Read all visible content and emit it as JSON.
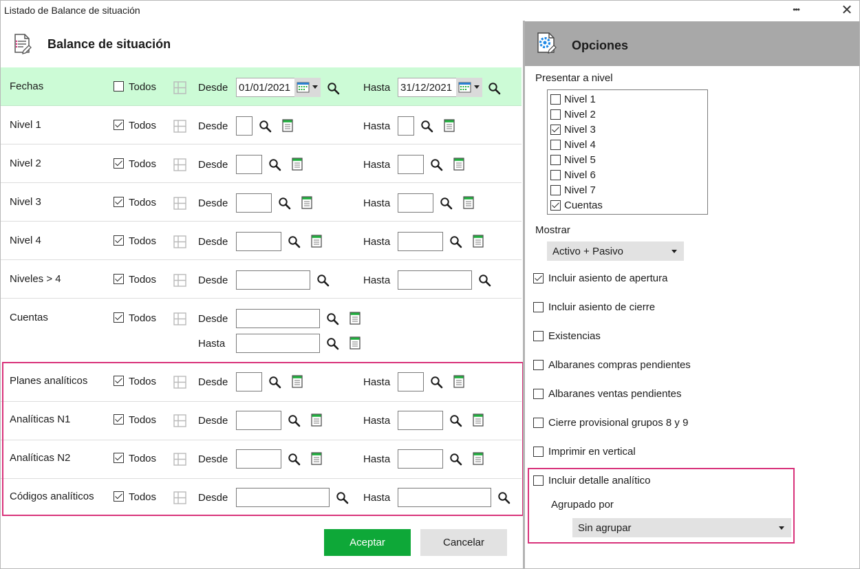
{
  "window": {
    "title": "Listado de Balance de situación",
    "menu_glyph": "•••",
    "close_glyph": "✕"
  },
  "left": {
    "title": "Balance de situación",
    "todos_label": "Todos",
    "desde_label": "Desde",
    "hasta_label": "Hasta",
    "rows": [
      {
        "label": "Fechas",
        "todos_checked": false,
        "desde": "01/01/2021",
        "hasta": "31/12/2021"
      },
      {
        "label": "Nivel 1",
        "todos_checked": true
      },
      {
        "label": "Nivel 2",
        "todos_checked": true
      },
      {
        "label": "Nivel 3",
        "todos_checked": true
      },
      {
        "label": "Nivel 4",
        "todos_checked": true
      },
      {
        "label": "Niveles > 4",
        "todos_checked": true
      },
      {
        "label": "Cuentas",
        "todos_checked": true
      },
      {
        "label": "Planes  analíticos",
        "todos_checked": true
      },
      {
        "label": "Analíticas  N1",
        "todos_checked": true
      },
      {
        "label": "Analíticas  N2",
        "todos_checked": true
      },
      {
        "label": "Códigos analíticos",
        "todos_checked": true
      }
    ],
    "accept_label": "Aceptar",
    "cancel_label": "Cancelar"
  },
  "right": {
    "title": "Opciones",
    "presentar_label": "Presentar a nivel",
    "levels": [
      {
        "label": "Nivel 1",
        "checked": false
      },
      {
        "label": "Nivel 2",
        "checked": false
      },
      {
        "label": "Nivel 3",
        "checked": true
      },
      {
        "label": "Nivel 4",
        "checked": false
      },
      {
        "label": "Nivel 5",
        "checked": false
      },
      {
        "label": "Nivel 6",
        "checked": false
      },
      {
        "label": "Nivel 7",
        "checked": false
      },
      {
        "label": "Cuentas",
        "checked": true
      }
    ],
    "mostrar_label": "Mostrar",
    "mostrar_value": "Activo + Pasivo",
    "options": [
      {
        "label": "Incluir asiento de apertura",
        "checked": true
      },
      {
        "label": "Incluir asiento de cierre",
        "checked": false
      },
      {
        "label": "Existencias",
        "checked": false
      },
      {
        "label": "Albaranes compras pendientes",
        "checked": false
      },
      {
        "label": "Albaranes ventas pendientes",
        "checked": false
      },
      {
        "label": "Cierre provisional grupos 8 y 9",
        "checked": false
      },
      {
        "label": "Imprimir en vertical",
        "checked": false
      },
      {
        "label": "Incluir detalle analítico",
        "checked": false
      }
    ],
    "agrupado_label": "Agrupado por",
    "agrupado_value": "Sin agrupar"
  },
  "colors": {
    "accent_green": "#0ea838",
    "highlight_pink": "#d8327a",
    "fechas_row_bg": "#ccfbd6",
    "panel_header_gray": "#a8a8a8"
  },
  "icons": [
    "report-icon",
    "options-gear-icon",
    "grid-icon",
    "calendar-icon",
    "search-icon",
    "document-icon",
    "chevron-down-icon",
    "close-icon",
    "more-icon"
  ]
}
